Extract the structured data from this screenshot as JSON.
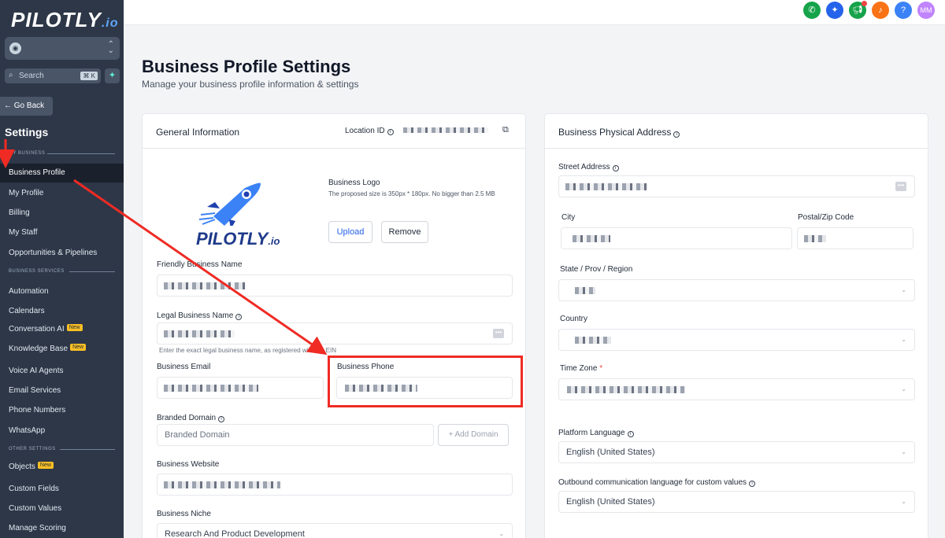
{
  "sidebar": {
    "logo": "PILOTLY",
    "logo_suffix": ".io",
    "search_placeholder": "Search",
    "search_shortcut": "⌘ K",
    "go_back": "← Go Back",
    "title": "Settings",
    "section_my_business": "MY BUSINESS",
    "section_business_services": "BUSINESS SERVICES",
    "section_other_settings": "OTHER SETTINGS",
    "items": [
      "Business Profile",
      "My Profile",
      "Billing",
      "My Staff",
      "Opportunities & Pipelines",
      "Automation",
      "Calendars",
      "Conversation AI",
      "Knowledge Base",
      "Voice AI Agents",
      "Email Services",
      "Phone Numbers",
      "WhatsApp",
      "Objects",
      "Custom Fields",
      "Custom Values",
      "Manage Scoring"
    ],
    "new_badge": "New"
  },
  "topbar": {
    "avatar_initials": "MM",
    "icons": [
      "phone-icon",
      "sparkle-icon",
      "megaphone-icon",
      "bell-icon",
      "help-icon"
    ],
    "colors": [
      "#16a34a",
      "#2563eb",
      "#16a34a",
      "#f97316",
      "#3b82f6"
    ]
  },
  "page": {
    "title": "Business Profile Settings",
    "subtitle": "Manage your business profile information & settings"
  },
  "general": {
    "title": "General Information",
    "location_id_label": "Location ID",
    "logo_label": "Business Logo",
    "logo_hint": "The proposed size is 350px * 180px. No bigger than 2.5 MB",
    "upload": "Upload",
    "remove": "Remove",
    "friendly_name_label": "Friendly Business Name",
    "legal_name_label": "Legal Business Name",
    "legal_hint": "Enter the exact legal business name, as registered with the EIN",
    "email_label": "Business Email",
    "phone_label": "Business Phone",
    "branded_domain_label": "Branded Domain",
    "branded_domain_placeholder": "Branded Domain",
    "add_domain": "+ Add Domain",
    "website_label": "Business Website",
    "niche_label": "Business Niche",
    "niche_value": "Research And Product Development"
  },
  "address": {
    "title": "Business Physical Address",
    "street_label": "Street Address",
    "city_label": "City",
    "postal_label": "Postal/Zip Code",
    "state_label": "State / Prov / Region",
    "country_label": "Country",
    "timezone_label": "Time Zone",
    "required_mark": "*",
    "platform_lang_label": "Platform Language",
    "platform_lang_value": "English (United States)",
    "outbound_lang_label": "Outbound communication language for custom values",
    "outbound_lang_value": "English (United States)"
  }
}
